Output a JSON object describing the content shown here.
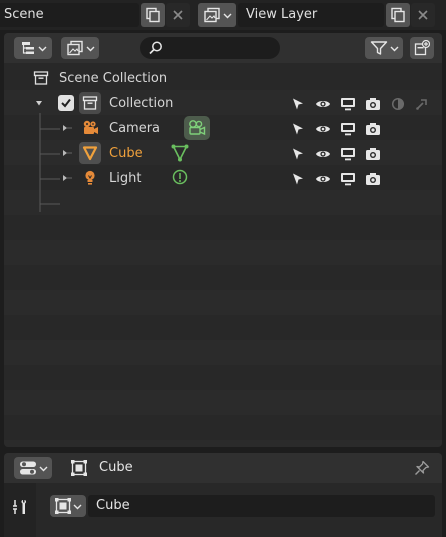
{
  "topbar": {
    "scene_label": "Scene",
    "view_layer_label": "View Layer",
    "scene_new_icon": "duplicate-icon",
    "close_icon": "close-icon"
  },
  "outliner": {
    "display_mode_icon": "outliner-display-mode-icon",
    "filter_icon": "filter-icon",
    "new_collection_icon": "new-collection-icon",
    "search": {
      "placeholder": "",
      "value": ""
    },
    "scene_collection_label": "Scene Collection",
    "rows": [
      {
        "label": "Collection",
        "icon": "collection-icon",
        "type": "collection"
      },
      {
        "label": "Camera",
        "icon": "camera-object-icon",
        "data_icon": "camera-data-icon",
        "type": "object"
      },
      {
        "label": "Cube",
        "icon": "mesh-object-icon",
        "data_icon": "mesh-data-icon",
        "type": "object",
        "active": true
      },
      {
        "label": "Light",
        "icon": "light-object-icon",
        "data_icon": "light-data-icon",
        "type": "object"
      }
    ],
    "restrict_icons": [
      "select-arrow-icon",
      "eye-icon",
      "monitor-icon",
      "camera-render-icon"
    ],
    "collection_extra_icons": [
      "holdout-icon",
      "indirect-only-icon"
    ]
  },
  "properties": {
    "editor_type_icon": "properties-editor-icon",
    "header_object_icon": "object-icon",
    "header_name": "Cube",
    "pin_icon": "pin-icon",
    "tool_tab_icon": "tool-settings-icon",
    "object_name_value": "Cube"
  },
  "colors": {
    "active_orange": "#f0a13c",
    "data_green": "#6abf5f",
    "object_orange": "#e58a39"
  }
}
